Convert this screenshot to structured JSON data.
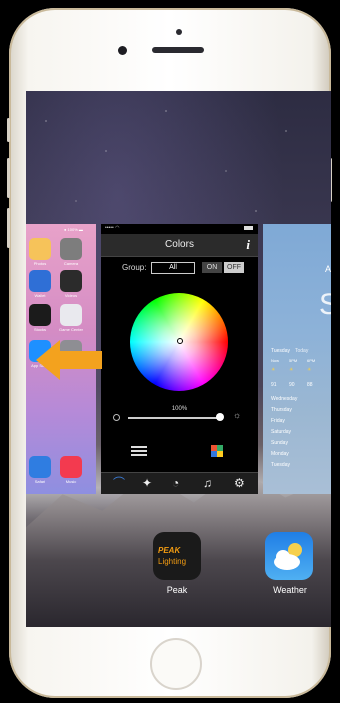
{
  "colors_app": {
    "title": "Colors",
    "info_glyph": "i",
    "group_label": "Group:",
    "group_value": "All",
    "on_label": "ON",
    "off_label": "OFF",
    "brightness_percent": "100%",
    "brightness_level": 1.0,
    "status_left": "••••• ◠"
  },
  "home_card": {
    "status": "● 100% ▬",
    "icons": [
      {
        "name": "photos-icon",
        "color": "#f6c35a",
        "label": "Photos"
      },
      {
        "name": "camera-icon",
        "color": "#7d7d7d",
        "label": "Camera"
      },
      {
        "name": "wallet-icon",
        "color": "#2f6fd6",
        "label": "Wallet"
      },
      {
        "name": "videos-icon",
        "color": "#2b2b2b",
        "label": "Videos"
      },
      {
        "name": "stocks-icon",
        "color": "#1b1b1b",
        "label": "Stocks"
      },
      {
        "name": "game-center-icon",
        "color": "#e9e9ee",
        "label": "Game Center"
      },
      {
        "name": "app-store-icon",
        "color": "#1e90ff",
        "label": "App Store"
      },
      {
        "name": "settings-icon",
        "color": "#8e8e93",
        "label": "Settings"
      },
      {
        "name": "safari-icon",
        "color": "#2f7de1",
        "label": "Safari"
      },
      {
        "name": "music-icon",
        "color": "#f33a4f",
        "label": "Music"
      }
    ]
  },
  "weather_card": {
    "city_initial": "A",
    "temp_initial": "S",
    "day_row": "Tuesday",
    "day_row_sub": "Today",
    "times": [
      "Now",
      "5PM",
      "6PM"
    ],
    "temps": [
      "91",
      "90",
      "88"
    ],
    "days": [
      "Wednesday",
      "Thursday",
      "Friday",
      "Saturday",
      "Sunday",
      "Monday",
      "Tuesday"
    ]
  },
  "dock": {
    "peak_logo": "PEAK",
    "peak_sub": "Lighting",
    "peak_label": "Peak",
    "weather_label": "Weather"
  },
  "colors": {
    "arrow": "#f3a21e",
    "peak_accent": "#f39c12"
  }
}
